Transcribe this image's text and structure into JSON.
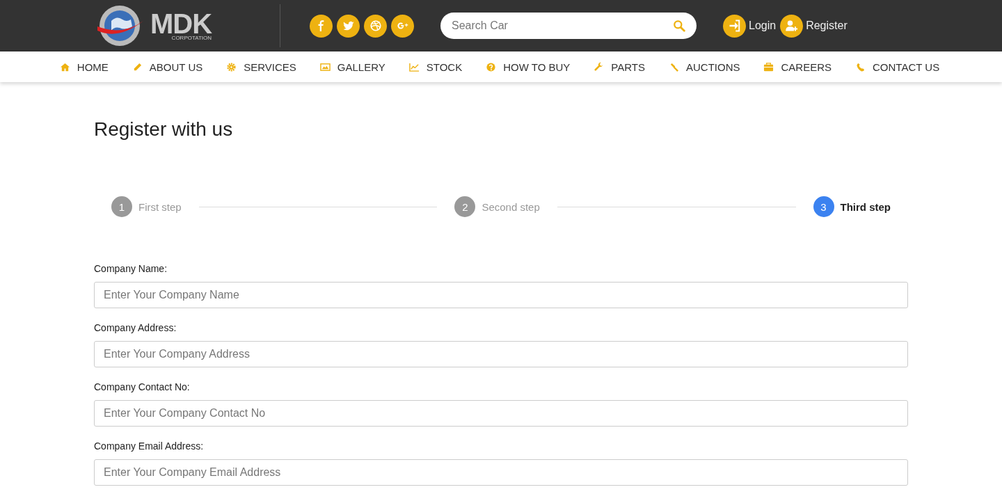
{
  "header": {
    "logo": {
      "name": "MDK",
      "tagline": "CORPOTATION"
    },
    "search": {
      "placeholder": "Search Car"
    },
    "account_links": [
      {
        "label": "Login"
      },
      {
        "label": "Register"
      }
    ]
  },
  "nav": {
    "items": [
      {
        "label": "HOME"
      },
      {
        "label": "ABOUT US"
      },
      {
        "label": "SERVICES"
      },
      {
        "label": "GALLERY"
      },
      {
        "label": "STOCK"
      },
      {
        "label": "HOW TO BUY"
      },
      {
        "label": "PARTS"
      },
      {
        "label": "AUCTIONS"
      },
      {
        "label": "CAREERS"
      },
      {
        "label": "CONTACT US"
      }
    ]
  },
  "page": {
    "title": "Register with us",
    "steps": [
      {
        "number": "1",
        "label": "First step",
        "selected": false
      },
      {
        "number": "2",
        "label": "Second step",
        "selected": false
      },
      {
        "number": "3",
        "label": "Third step",
        "selected": true
      }
    ],
    "fields": [
      {
        "label": "Company Name:",
        "placeholder": "Enter Your Company Name"
      },
      {
        "label": "Company Address:",
        "placeholder": "Enter Your Company Address"
      },
      {
        "label": "Company Contact No:",
        "placeholder": "Enter Your Company Contact No"
      },
      {
        "label": "Company Email Address:",
        "placeholder": "Enter Your Company Email Address"
      }
    ]
  }
}
